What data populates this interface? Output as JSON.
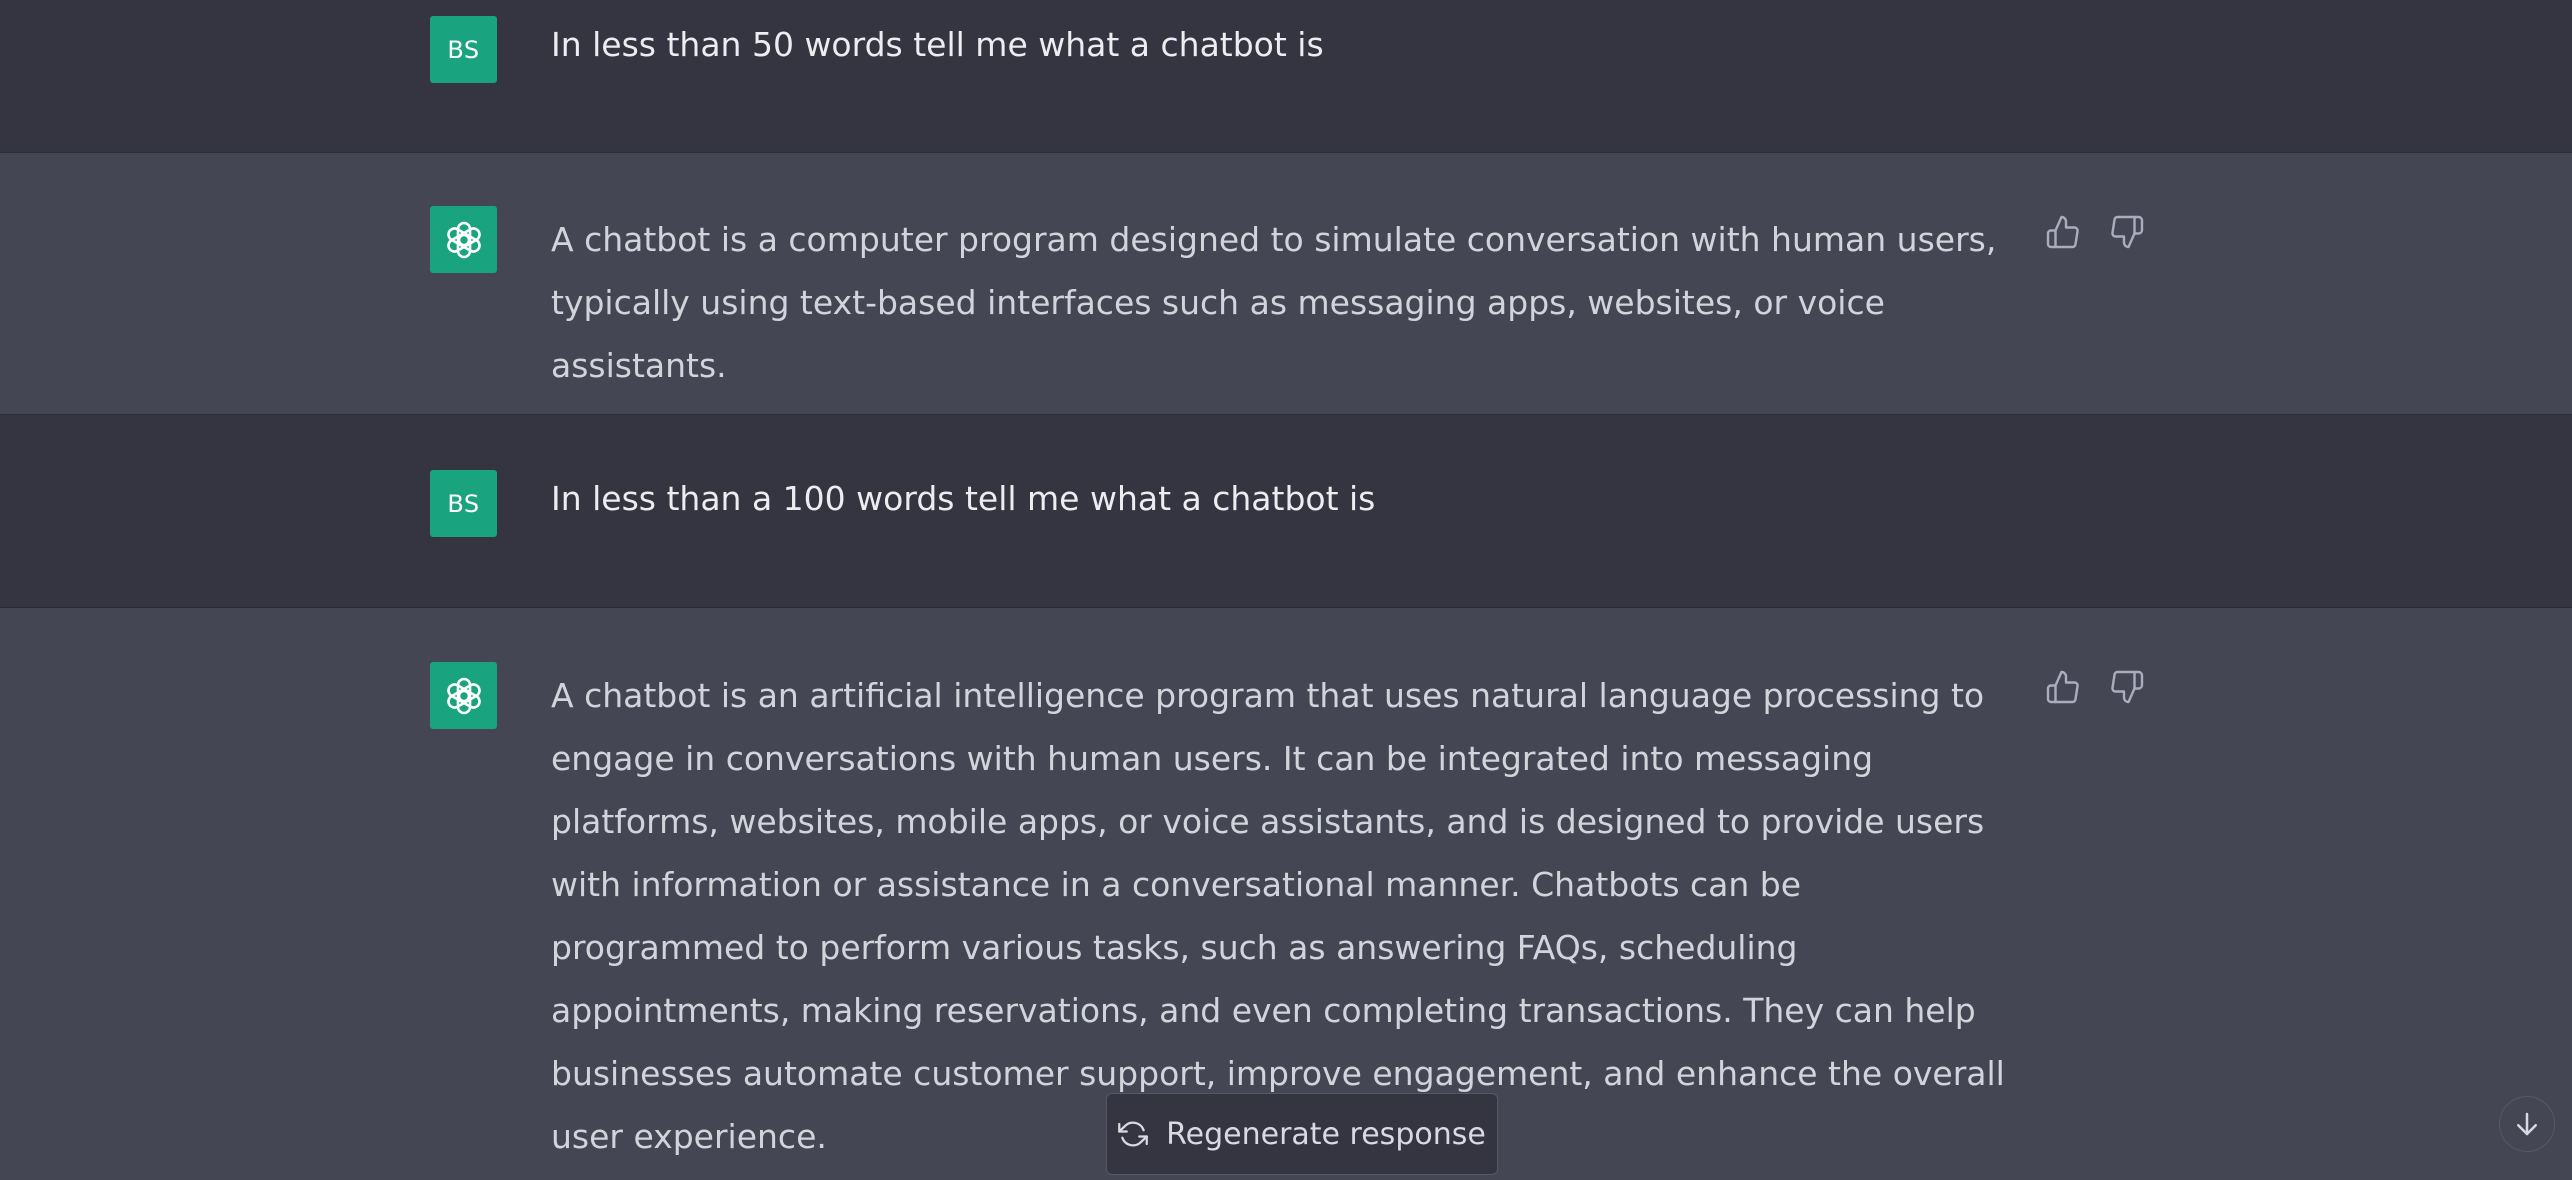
{
  "conversation": {
    "turns": [
      {
        "role": "user",
        "avatar_label": "BS",
        "text": "In less than 50 words tell me what a chatbot is"
      },
      {
        "role": "assistant",
        "avatar_icon": "openai-logo-icon",
        "text": "A chatbot is a computer program designed to simulate conversation with human users, typically using text-based interfaces such as messaging apps, websites, or voice assistants."
      },
      {
        "role": "user",
        "avatar_label": "BS",
        "text": "In less than a 100 words tell me what a chatbot is"
      },
      {
        "role": "assistant",
        "avatar_icon": "openai-logo-icon",
        "text": "A chatbot is an artificial intelligence program that uses natural language processing to engage in conversations with human users. It can be integrated into messaging platforms, websites, mobile apps, or voice assistants, and is designed to provide users with information or assistance in a conversational manner. Chatbots can be programmed to perform various tasks, such as answering FAQs, scheduling appointments, making reservations, and even completing transactions. They can help businesses automate customer support, improve engagement, and enhance the overall user experience."
      }
    ]
  },
  "controls": {
    "regenerate_label": "Regenerate response",
    "regenerate_icon": "refresh-icon",
    "scroll_down_icon": "arrow-down-icon",
    "thumbs_up_icon": "thumbs-up-icon",
    "thumbs_down_icon": "thumbs-down-icon"
  },
  "colors": {
    "page_background": "#343541",
    "assistant_background": "#444654",
    "avatar_green": "#19a37f",
    "user_text": "#ececf1",
    "assistant_text": "#d1d5db"
  }
}
